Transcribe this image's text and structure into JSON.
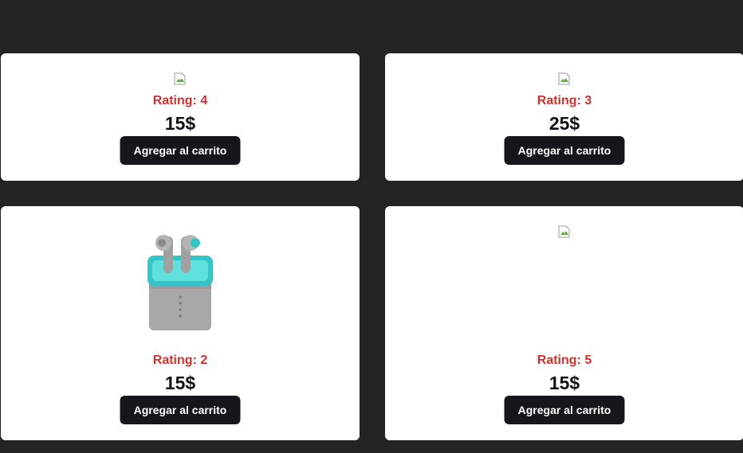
{
  "products": [
    {
      "rating": "Rating: 4",
      "price": "15$",
      "button": "Agregar al carrito",
      "image": "broken-image-icon"
    },
    {
      "rating": "Rating: 3",
      "price": "25$",
      "button": "Agregar al carrito",
      "image": "broken-image-icon"
    },
    {
      "rating": "Rating: 2",
      "price": "15$",
      "button": "Agregar al carrito",
      "image": "earbuds-product-image"
    },
    {
      "rating": "Rating: 5",
      "price": "15$",
      "button": "Agregar al carrito",
      "image": "broken-image-icon"
    }
  ],
  "colors": {
    "background": "#242426",
    "card": "#ffffff",
    "rating": "#d0312d",
    "price": "#111318",
    "button": "#16171d"
  }
}
